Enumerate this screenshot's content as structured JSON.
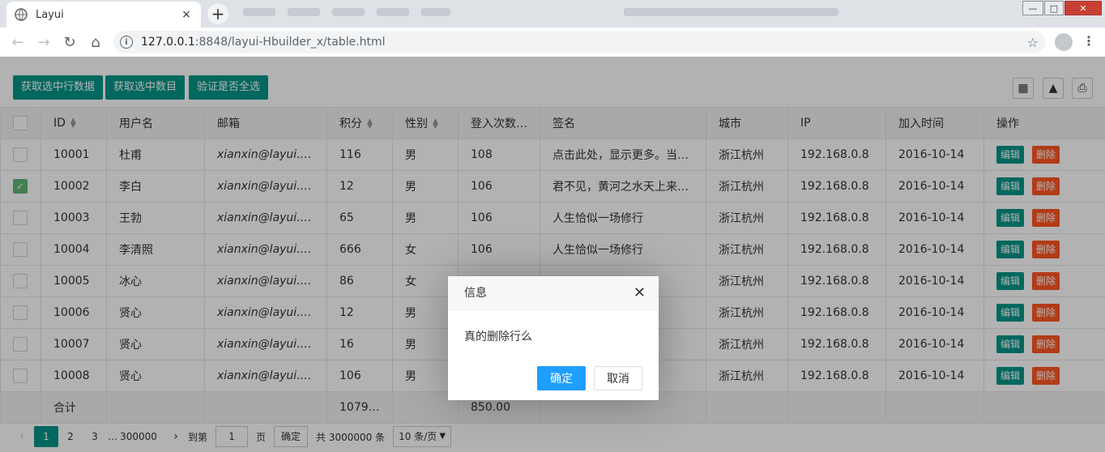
{
  "browser": {
    "tab_title": "Layui",
    "tab_close": "×",
    "new_tab": "+",
    "url_host": "127.0.0.1",
    "url_rest": ":8848/layui-Hbuilder_x/table.html"
  },
  "toolbar": {
    "buttons": [
      "获取选中行数据",
      "获取选中数目",
      "验证是否全选"
    ]
  },
  "table": {
    "headers": [
      "ID",
      "用户名",
      "邮箱",
      "积分",
      "性别",
      "登入次数…",
      "签名",
      "城市",
      "IP",
      "加入时间",
      "操作"
    ],
    "edit_label": "编辑",
    "delete_label": "删除",
    "rows": [
      {
        "id": "10001",
        "user": "杜甫",
        "email": "xianxin@layui.com",
        "score": "116",
        "sex": "男",
        "logins": "108",
        "sign": "点击此处，显示更多。当…",
        "city": "浙江杭州",
        "ip": "192.168.0.8",
        "date": "2016-10-14",
        "checked": false
      },
      {
        "id": "10002",
        "user": "李白",
        "email": "xianxin@layui.com",
        "score": "12",
        "sex": "男",
        "logins": "106",
        "sign": "君不见，黄河之水天上来…",
        "city": "浙江杭州",
        "ip": "192.168.0.8",
        "date": "2016-10-14",
        "checked": true
      },
      {
        "id": "10003",
        "user": "王勃",
        "email": "xianxin@layui.com",
        "score": "65",
        "sex": "男",
        "logins": "106",
        "sign": "人生恰似一场修行",
        "city": "浙江杭州",
        "ip": "192.168.0.8",
        "date": "2016-10-14",
        "checked": false
      },
      {
        "id": "10004",
        "user": "李清照",
        "email": "xianxin@layui.com",
        "score": "666",
        "sex": "女",
        "logins": "106",
        "sign": "人生恰似一场修行",
        "city": "浙江杭州",
        "ip": "192.168.0.8",
        "date": "2016-10-14",
        "checked": false
      },
      {
        "id": "10005",
        "user": "冰心",
        "email": "xianxin@layui.com",
        "score": "86",
        "sex": "女",
        "logins": "",
        "sign": "",
        "city": "浙江杭州",
        "ip": "192.168.0.8",
        "date": "2016-10-14",
        "checked": false
      },
      {
        "id": "10006",
        "user": "贤心",
        "email": "xianxin@layui.com",
        "score": "12",
        "sex": "男",
        "logins": "",
        "sign": "",
        "city": "浙江杭州",
        "ip": "192.168.0.8",
        "date": "2016-10-14",
        "checked": false
      },
      {
        "id": "10007",
        "user": "贤心",
        "email": "xianxin@layui.com",
        "score": "16",
        "sex": "男",
        "logins": "",
        "sign": "",
        "city": "浙江杭州",
        "ip": "192.168.0.8",
        "date": "2016-10-14",
        "checked": false
      },
      {
        "id": "10008",
        "user": "贤心",
        "email": "xianxin@layui.com",
        "score": "106",
        "sex": "男",
        "logins": "",
        "sign": "",
        "city": "浙江杭州",
        "ip": "192.168.0.8",
        "date": "2016-10-14",
        "checked": false
      }
    ],
    "total_label": "合计",
    "total_score": "1079.…",
    "total_logins": "850.00"
  },
  "pager": {
    "pages": [
      "1",
      "2",
      "3"
    ],
    "ellipsis": "…",
    "last_page": "300000",
    "goto_label": "到第",
    "goto_value": "1",
    "page_label": "页",
    "confirm_label": "确定",
    "total_text": "共 3000000 条",
    "page_size": "10 条/页"
  },
  "dialog": {
    "title": "信息",
    "message": "真的删除行么",
    "ok_label": "确定",
    "cancel_label": "取消"
  },
  "colors": {
    "primary": "#009688",
    "danger": "#ff5722",
    "dialog_ok": "#1e9fff",
    "checked": "#5fb878"
  }
}
